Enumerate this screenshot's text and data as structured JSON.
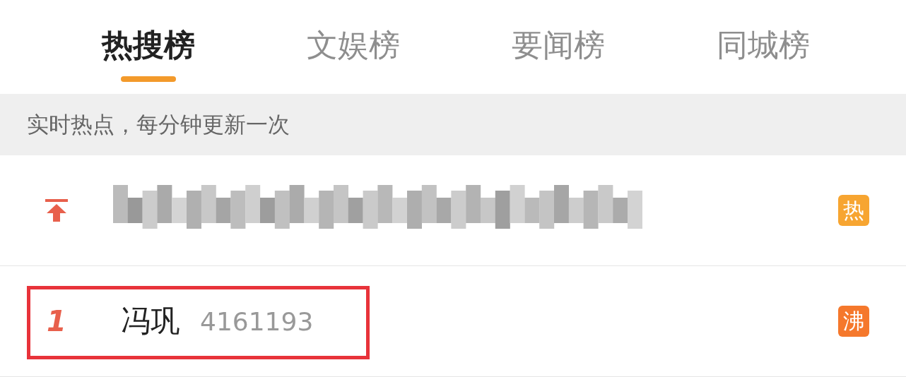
{
  "tabs": [
    {
      "label": "热搜榜",
      "selected": true
    },
    {
      "label": "文娱榜",
      "selected": false
    },
    {
      "label": "要闻榜",
      "selected": false
    },
    {
      "label": "同城榜",
      "selected": false
    }
  ],
  "notice": "实时热点，每分钟更新一次",
  "rows": [
    {
      "kind": "pinned",
      "badge": "热",
      "color": "#f7a531",
      "highlighted": false
    },
    {
      "kind": "ranked",
      "rank": "1",
      "title": "冯巩",
      "count": "4161193",
      "badge": "沸",
      "color": "#f5782c",
      "highlighted": true
    }
  ]
}
